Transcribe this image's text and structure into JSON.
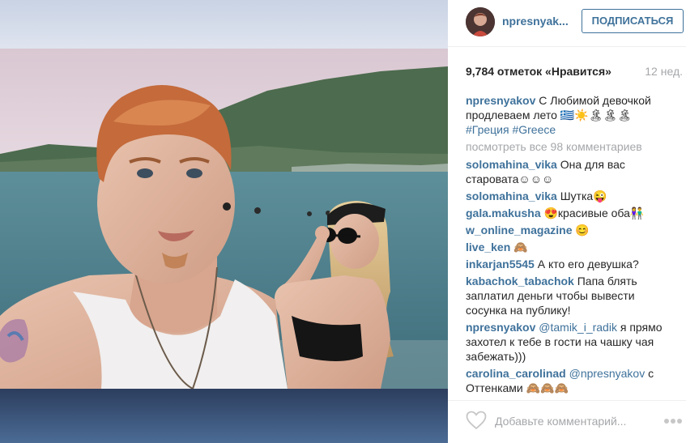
{
  "post": {
    "username": "npresnyakov",
    "username_short": "npresnyak...",
    "follow_label": "ПОДПИСАТЬСЯ",
    "likes_text": "9,784 отметок «Нравится»",
    "age_text": "12 нед.",
    "view_all_text": "посмотреть все 98 комментариев",
    "add_comment_placeholder": "Добавьте комментарий..."
  },
  "caption": {
    "user": "npresnyakov",
    "text": "С Любимой девочкой продлеваем лето 🇬🇷☀️🏝🏝🏝",
    "tag1": "#Греция",
    "tag2": "#Greece"
  },
  "comments": [
    {
      "user": "solomahina_vika",
      "text": "Она для вас старовата☺☺☺"
    },
    {
      "user": "solomahina_vika",
      "text": "Шутка😜"
    },
    {
      "user": "gala.makusha",
      "text": "😍красивые оба👫"
    },
    {
      "user": "w_online_magazine",
      "text": "😊"
    },
    {
      "user": "live_ken",
      "text": "🙈"
    },
    {
      "user": "inkarjan5545",
      "text": "А кто его девушка?"
    },
    {
      "user": "kabachok_tabachok",
      "text": "Папа блять заплатил деньги чтобы вывести сосунка на публику!"
    },
    {
      "user": "npresnyakov",
      "mention": "@tamik_i_radik",
      "text": "я прямо захотел к тебе в гости на чашку чая забежать)))"
    },
    {
      "user": "carolina_carolinad",
      "mention": "@npresnyakov",
      "text": "с Оттенками 🙈🙈🙈"
    }
  ],
  "colors": {
    "link_blue": "#3f729b",
    "muted_gray": "#a5a7aa",
    "text_dark": "#262626"
  },
  "icons": {
    "like": "heart-icon",
    "more": "ellipsis-icon",
    "avatar": "avatar"
  }
}
